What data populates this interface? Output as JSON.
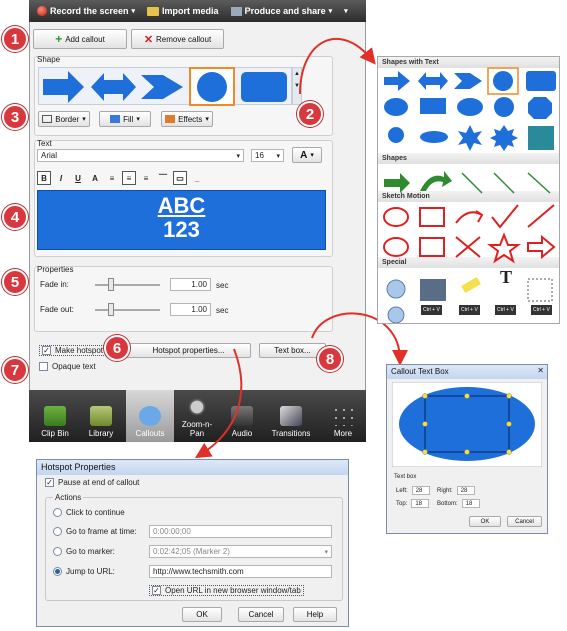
{
  "topbar": {
    "record": "Record the screen",
    "import": "Import media",
    "produce": "Produce and share"
  },
  "buttons": {
    "add_callout": "Add callout",
    "remove_callout": "Remove callout",
    "border": "Border",
    "fill": "Fill",
    "effects": "Effects",
    "hotspot_properties": "Hotspot properties...",
    "text_box": "Text box..."
  },
  "labels": {
    "shape": "Shape",
    "text": "Text",
    "properties": "Properties",
    "fade_in": "Fade in:",
    "fade_out": "Fade out:",
    "sec": "sec",
    "make_hotspot": "Make hotspot",
    "opaque_text": "Opaque text"
  },
  "text_settings": {
    "font": "Arial",
    "size": "16",
    "font_color_letter": "A",
    "preview_line1": "ABC",
    "preview_line2": "123"
  },
  "properties": {
    "fade_in": "1.00",
    "fade_out": "1.00",
    "make_hotspot_checked": true,
    "opaque_text_checked": false
  },
  "tabs": [
    {
      "label": "Clip Bin"
    },
    {
      "label": "Library"
    },
    {
      "label": "Callouts"
    },
    {
      "label": "Zoom-n-\nPan"
    },
    {
      "label": "Audio"
    },
    {
      "label": "Transitions"
    },
    {
      "label": "More"
    }
  ],
  "badges": [
    "1",
    "2",
    "3",
    "4",
    "5",
    "6",
    "7",
    "8"
  ],
  "shapes_popup": {
    "sections": [
      "Shapes with Text",
      "Shapes",
      "Sketch Motion",
      "Special"
    ],
    "special_keys": [
      "Ctrl + V",
      "Ctrl + V",
      "Ctrl + V",
      "Ctrl + V"
    ],
    "text_icon": "T"
  },
  "callout_text_box": {
    "title": "Callout Text Box",
    "group": "Text box",
    "left_label": "Left:",
    "left": "28",
    "right_label": "Right:",
    "right": "28",
    "top_label": "Top:",
    "top": "18",
    "bottom_label": "Bottom:",
    "bottom": "18",
    "ok": "OK",
    "cancel": "Cancel"
  },
  "hotspot_dialog": {
    "title": "Hotspot Properties",
    "pause": "Pause at end of callout",
    "actions": "Actions",
    "click_continue": "Click to continue",
    "goto_frame": "Go to frame at time:",
    "frame_value": "0:00:00;00",
    "goto_marker": "Go to marker:",
    "marker_value": "0:02:42;05 (Marker 2)",
    "jump_url": "Jump to URL:",
    "url_value": "http://www.techsmith.com",
    "open_new": "Open URL in new browser window/tab",
    "ok": "OK",
    "cancel": "Cancel",
    "help": "Help"
  },
  "colors": {
    "accent_blue": "#1e6fd9",
    "badge_red": "#d8383d",
    "sketch_red": "#e02020",
    "arrow_green": "#2e8b2e"
  }
}
